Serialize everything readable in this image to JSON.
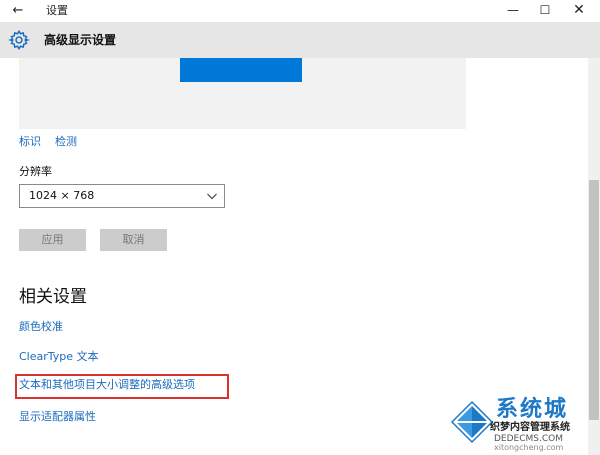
{
  "window": {
    "title": "设置",
    "back_glyph": "←",
    "minimize_glyph": "—",
    "maximize_glyph": "☐",
    "close_glyph": "✕"
  },
  "header": {
    "icon": "gear-icon",
    "title": "高级显示设置"
  },
  "preview": {
    "links": [
      "标识",
      "检测"
    ],
    "monitor_color": "#0078d7"
  },
  "resolution": {
    "label": "分辨率",
    "value": "1024 × 768"
  },
  "buttons": {
    "apply": "应用",
    "cancel": "取消"
  },
  "related": {
    "title": "相关设置",
    "links": [
      "颜色校准",
      "ClearType 文本",
      "文本和其他项目大小调整的高级选项",
      "显示适配器属性"
    ],
    "highlight_color": "#d9322f"
  },
  "watermark": {
    "brand": "系统城",
    "line1": "织梦内容管理系统",
    "line2": "DEDECMS.COM",
    "line3": "xitongcheng.com"
  },
  "colors": {
    "accent": "#0078d7",
    "link": "#1a6bbf"
  }
}
